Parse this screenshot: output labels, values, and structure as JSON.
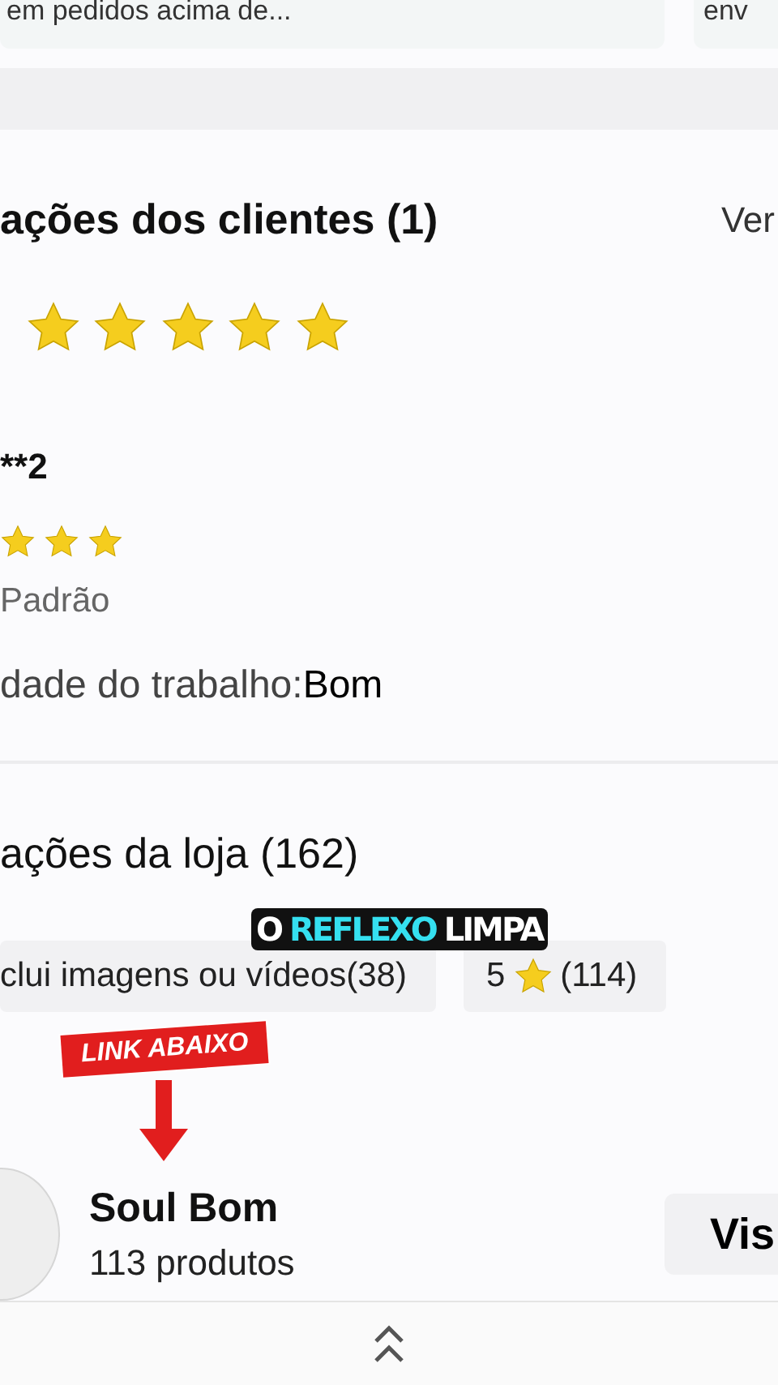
{
  "top_cards": [
    {
      "text": "em pedidos acima de..."
    },
    {
      "text": "env"
    }
  ],
  "customer_reviews": {
    "title": "ações dos clientes (1)",
    "link": "Ver",
    "stars": 5,
    "review": {
      "author": "**2",
      "stars": 3,
      "variant": "Padrão",
      "quality_label": "dade do trabalho:",
      "quality_value": "Bom"
    }
  },
  "store_reviews": {
    "title": "ações da loja (162)",
    "filters": [
      {
        "kind": "text",
        "label": "clui imagens ou vídeos(38)"
      },
      {
        "kind": "rating",
        "rating": "5",
        "count": "(114)"
      }
    ]
  },
  "store": {
    "name": "Soul Bom",
    "products": "113 produtos",
    "button": "Vis"
  },
  "overlays": {
    "caption": [
      {
        "text": "O",
        "highlight": false
      },
      {
        "text": "REFLEXO",
        "highlight": true
      },
      {
        "text": "LIMPA",
        "highlight": false
      }
    ],
    "badge": "LINK ABAIXO"
  }
}
